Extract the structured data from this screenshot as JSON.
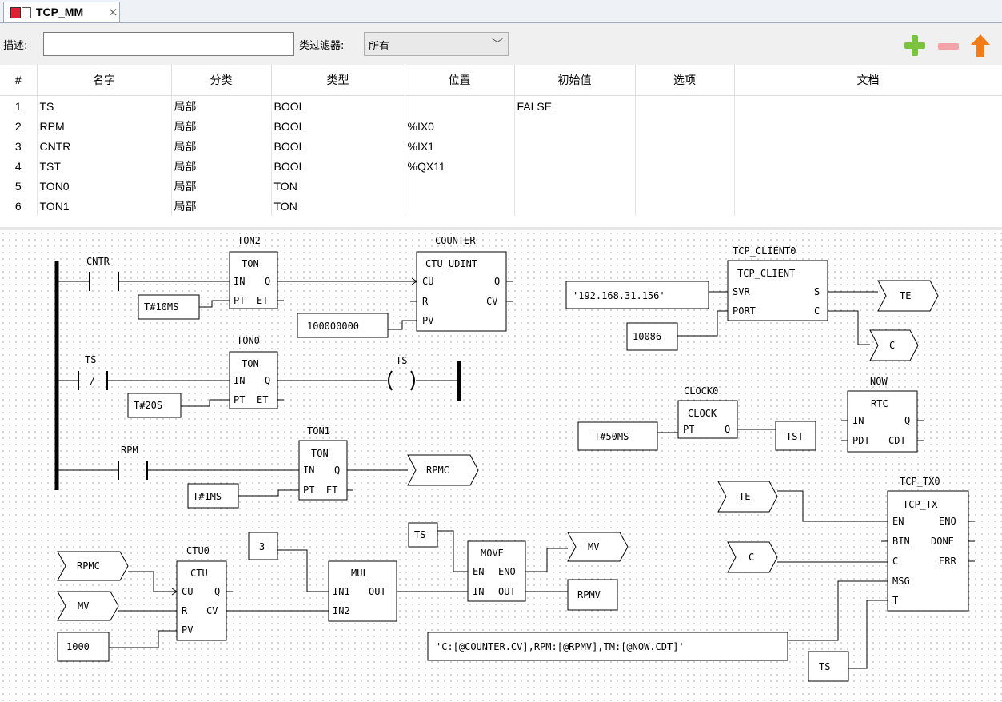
{
  "tab": {
    "title": "TCP_MM",
    "close": "×"
  },
  "filter": {
    "desc_label": "描述:",
    "desc_value": "",
    "class_label": "类过滤器:",
    "class_value": "所有",
    "chevron": "﹀"
  },
  "toolbar": {
    "add_icon": "plus-icon",
    "remove_icon": "minus-icon",
    "up_icon": "arrow-up-icon"
  },
  "colors": {
    "add": "#7cc242",
    "remove": "#f2a3a8",
    "up": "#f07c1a"
  },
  "table": {
    "headers": [
      "#",
      "名字",
      "分类",
      "类型",
      "位置",
      "初始值",
      "选项",
      "文档"
    ],
    "rows": [
      [
        "1",
        "TS",
        "局部",
        "BOOL",
        "",
        "FALSE",
        "",
        ""
      ],
      [
        "2",
        "RPM",
        "局部",
        "BOOL",
        "%IX0",
        "",
        "",
        ""
      ],
      [
        "3",
        "CNTR",
        "局部",
        "BOOL",
        "%IX1",
        "",
        "",
        ""
      ],
      [
        "4",
        "TST",
        "局部",
        "BOOL",
        "%QX11",
        "",
        "",
        ""
      ],
      [
        "5",
        "TON0",
        "局部",
        "TON",
        "",
        "",
        "",
        ""
      ],
      [
        "6",
        "TON1",
        "局部",
        "TON",
        "",
        "",
        "",
        ""
      ]
    ]
  },
  "diagram": {
    "contacts": {
      "cntr": "CNTR",
      "ts": "TS",
      "ts_neg": "/",
      "rpm": "RPM"
    },
    "coil": {
      "ts": "TS"
    },
    "ton2": {
      "instance": "TON2",
      "type": "TON",
      "in": "IN",
      "q": "Q",
      "pt": "PT",
      "et": "ET"
    },
    "ton0": {
      "instance": "TON0",
      "type": "TON",
      "in": "IN",
      "q": "Q",
      "pt": "PT",
      "et": "ET"
    },
    "ton1": {
      "instance": "TON1",
      "type": "TON",
      "in": "IN",
      "q": "Q",
      "pt": "PT",
      "et": "ET"
    },
    "counter": {
      "instance": "COUNTER",
      "type": "CTU_UDINT",
      "cu": "CU",
      "r": "R",
      "pv": "PV",
      "q": "Q",
      "cv": "CV"
    },
    "ctu0": {
      "instance": "CTU0",
      "type": "CTU",
      "cu": "CU",
      "r": "R",
      "pv": "PV",
      "q": "Q",
      "cv": "CV"
    },
    "mul": {
      "type": "MUL",
      "in1": "IN1",
      "in2": "IN2",
      "out": "OUT"
    },
    "move": {
      "type": "MOVE",
      "en": "EN",
      "eno": "ENO",
      "in": "IN",
      "out": "OUT"
    },
    "tcp_client": {
      "instance": "TCP_CLIENT0",
      "type": "TCP_CLIENT",
      "svr": "SVR",
      "port": "PORT",
      "s": "S",
      "c": "C"
    },
    "clock": {
      "instance": "CLOCK0",
      "type": "CLOCK",
      "pt": "PT",
      "q": "Q"
    },
    "rtc": {
      "instance": "NOW",
      "type": "RTC",
      "in": "IN",
      "pdt": "PDT",
      "q": "Q",
      "cdt": "CDT"
    },
    "tcp_tx": {
      "instance": "TCP_TX0",
      "type": "TCP_TX",
      "en": "EN",
      "bin": "BIN",
      "c": "C",
      "msg": "MSG",
      "t": "T",
      "eno": "ENO",
      "done": "DONE",
      "err": "ERR"
    },
    "consts": {
      "t10ms": "T#10MS",
      "t20s": "T#20S",
      "t1ms": "T#1MS",
      "pv_counter": "100000000",
      "three": "3",
      "ts_move": "TS",
      "pv_ctu": "1000",
      "ip": "'192.168.31.156'",
      "port": "10086",
      "t50ms": "T#50MS",
      "tst": "TST",
      "rpmv": "RPMV",
      "ts_tx": "TS",
      "msg": "'C:[@COUNTER.CV],RPM:[@RPMV],TM:[@NOW.CDT]'"
    },
    "connectors": {
      "rpmc_out": "RPMC",
      "rpmc_in": "RPMC",
      "mv_in": "MV",
      "mv_out": "MV",
      "te_out": "TE",
      "c_out": "C",
      "te_in": "TE",
      "c_in": "C"
    }
  }
}
